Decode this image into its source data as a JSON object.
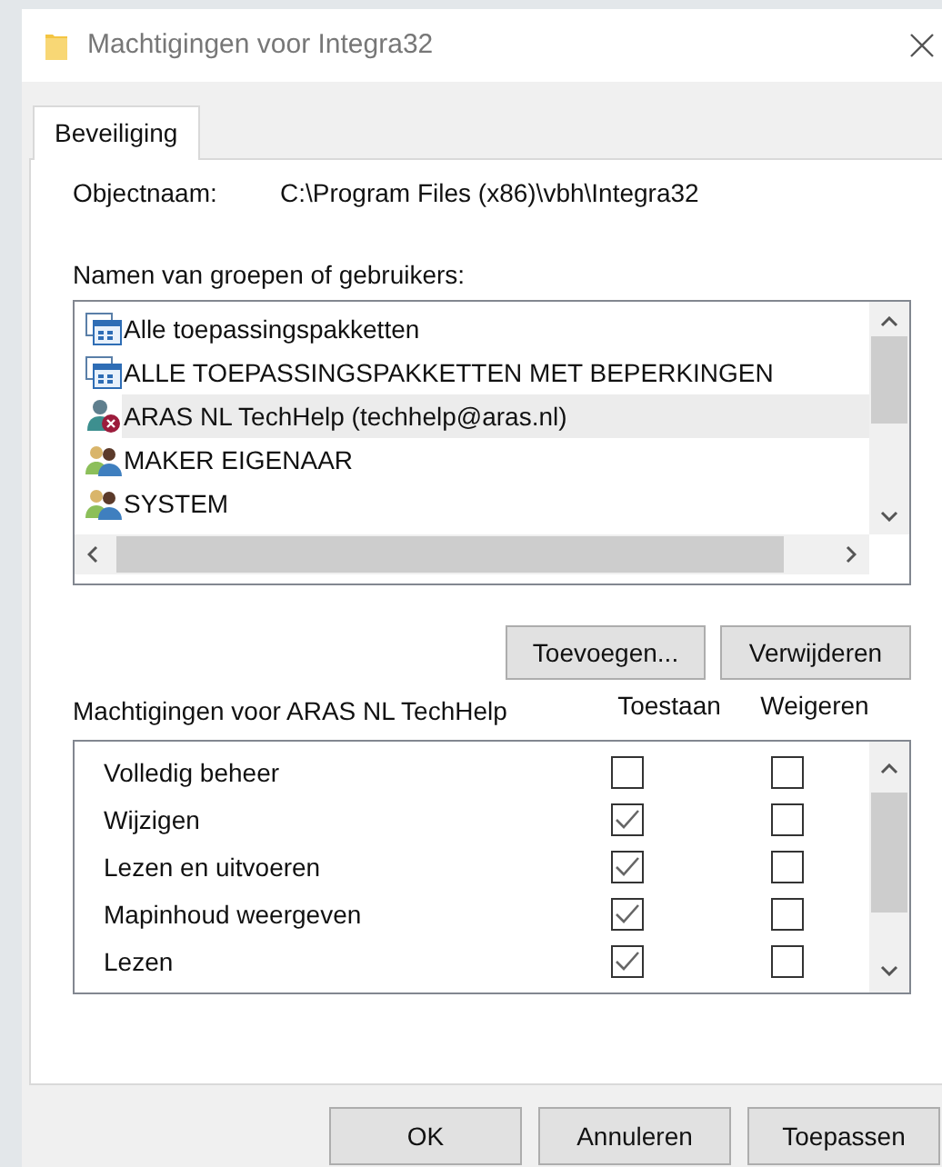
{
  "window": {
    "title": "Machtigingen voor Integra32"
  },
  "tabs": [
    {
      "label": "Beveiliging",
      "selected": true
    }
  ],
  "object": {
    "label": "Objectnaam:",
    "value": "C:\\Program Files (x86)\\vbh\\Integra32"
  },
  "users_label": "Namen van groepen of gebruikers:",
  "users": [
    {
      "name": "Alle toepassingspakketten",
      "kind": "package",
      "selected": false
    },
    {
      "name": "ALLE TOEPASSINGSPAKKETTEN MET BEPERKINGEN",
      "kind": "package",
      "selected": false
    },
    {
      "name": "ARAS NL TechHelp (techhelp@aras.nl)",
      "kind": "unknown-user",
      "selected": true
    },
    {
      "name": "MAKER EIGENAAR",
      "kind": "group",
      "selected": false
    },
    {
      "name": "SYSTEM",
      "kind": "group",
      "selected": false
    }
  ],
  "user_buttons": [
    "Toevoegen...",
    "Verwijderen"
  ],
  "permissions_label": "Machtigingen voor ARAS NL TechHelp",
  "columns": [
    "Toestaan",
    "Weigeren"
  ],
  "permissions": [
    {
      "name": "Volledig beheer",
      "allow": false,
      "deny": false
    },
    {
      "name": "Wijzigen",
      "allow": true,
      "deny": false
    },
    {
      "name": "Lezen en uitvoeren",
      "allow": true,
      "deny": false
    },
    {
      "name": "Mapinhoud weergeven",
      "allow": true,
      "deny": false
    },
    {
      "name": "Lezen",
      "allow": true,
      "deny": false
    }
  ],
  "buttons": [
    "OK",
    "Annuleren",
    "Toepassen"
  ]
}
